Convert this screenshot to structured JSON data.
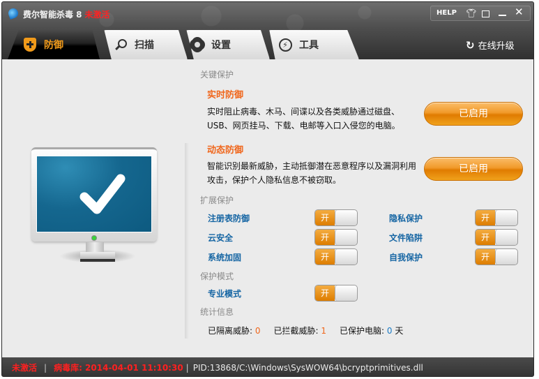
{
  "window": {
    "app_name": "费尔智能杀毒 8",
    "activation_status": "未激活",
    "help_label": "HELP",
    "icons": [
      "app-logo-icon",
      "skin-icon",
      "feedback-icon",
      "minimize-icon",
      "close-icon"
    ],
    "upgrade_label": "在线升级"
  },
  "tabs": [
    {
      "label": "防御",
      "icon": "shield-plus-icon",
      "active": true
    },
    {
      "label": "扫描",
      "icon": "search-icon",
      "active": false
    },
    {
      "label": "设置",
      "icon": "gear-icon",
      "active": false
    },
    {
      "label": "工具",
      "icon": "lightning-icon",
      "active": false
    }
  ],
  "key_protection": {
    "heading": "关键保护",
    "features": [
      {
        "title": "实时防御",
        "description": "实时阻止病毒、木马、间谍以及各类威胁通过磁盘、USB、网页挂马、下载、电邮等入口入侵您的电脑。",
        "button": "已启用"
      },
      {
        "title": "动态防御",
        "description": "智能识别最新威胁，主动抵御潜在恶意程序以及漏洞利用攻击，保护个人隐私信息不被窃取。",
        "button": "已启用"
      }
    ]
  },
  "extended_protection": {
    "heading": "扩展保护",
    "left": [
      {
        "label": "注册表防御",
        "toggle": "开",
        "on": true
      },
      {
        "label": "云安全",
        "toggle": "开",
        "on": true
      },
      {
        "label": "系统加固",
        "toggle": "开",
        "on": true
      }
    ],
    "right": [
      {
        "label": "隐私保护",
        "toggle": "开",
        "on": true
      },
      {
        "label": "文件陷阱",
        "toggle": "开",
        "on": true
      },
      {
        "label": "自我保护",
        "toggle": "开",
        "on": true
      }
    ]
  },
  "protection_mode": {
    "heading": "保护模式",
    "label": "专业模式",
    "toggle": "开",
    "on": true
  },
  "statistics": {
    "heading": "统计信息",
    "quarantined_label": "已隔离威胁:",
    "quarantined_value": "0",
    "blocked_label": "已拦截威胁:",
    "blocked_value": "1",
    "protected_label": "已保护电脑:",
    "protected_value": "0",
    "protected_unit": "天"
  },
  "statusbar": {
    "activation": "未激活",
    "separator": "|",
    "virus_db": "病毒库: 2014-04-01 11:10:30",
    "process": "PID:13868/C:\\Windows\\SysWOW64\\bcryptprimitives.dll"
  },
  "colors": {
    "accent_orange": "#f0661b",
    "button_orange": "#f19a2a",
    "option_blue": "#1565a3",
    "alert_red": "#ff2020"
  }
}
